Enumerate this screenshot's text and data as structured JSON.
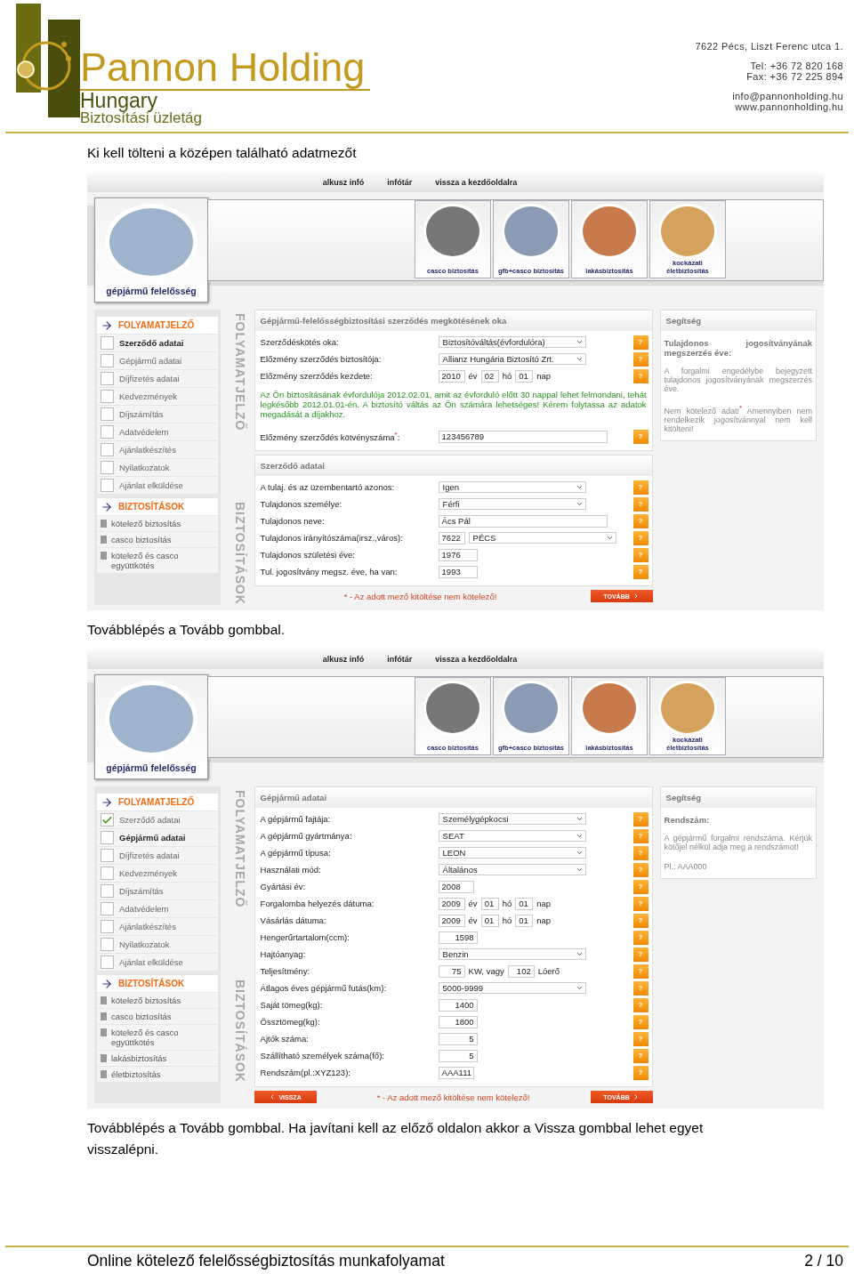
{
  "header": {
    "brand": "Pannon Holding",
    "country": "Hungary",
    "division": "Biztosítási üzletág",
    "contact": [
      "7622 Pécs, Liszt Ferenc utca 1.",
      "Tel: +36 72 820 168",
      "Fax: +36 72 225 894",
      "info@pannonholding.hu",
      "www.pannonholding.hu"
    ]
  },
  "sections": [
    {
      "caption": "Ki kell tölteni a középen található adatmezőt",
      "screenshot": {
        "nav_links": [
          "alkusz infó",
          "infótár",
          "vissza a kezdőoldalra"
        ],
        "main_card": {
          "label": "gépjármű felelősség"
        },
        "product_cards": [
          {
            "label": "casco biztosítás"
          },
          {
            "label": "gfb+casco biztosítás"
          },
          {
            "label": "lakásbiztosítás"
          },
          {
            "label": "kockázati életbiztosítás"
          }
        ],
        "progress": {
          "title": "FOLYAMATJELZŐ",
          "side_label": "FOLYAMATJELZŐ",
          "steps": [
            {
              "label": "Szerződő adatai",
              "checked": false,
              "selected": true
            },
            {
              "label": "Gépjármű adatai",
              "checked": false,
              "selected": false
            },
            {
              "label": "Díjfizetés adatai",
              "checked": false,
              "selected": false
            },
            {
              "label": "Kedvezmények",
              "checked": false,
              "selected": false
            },
            {
              "label": "Díjszámítás",
              "checked": false,
              "selected": false
            },
            {
              "label": "Adatvédelem",
              "checked": false,
              "selected": false
            },
            {
              "label": "Ajánlatkészítés",
              "checked": false,
              "selected": false
            },
            {
              "label": "Nyilatkozatok",
              "checked": false,
              "selected": false
            },
            {
              "label": "Ajánlat elküldése",
              "checked": false,
              "selected": false
            }
          ]
        },
        "insurances": {
          "title": "BIZTOSÍTÁSOK",
          "side_label": "BIZTOSÍTÁSOK",
          "items": [
            "kötelező biztosítás",
            "casco biztosítás",
            "kötelező és casco együttkötés"
          ]
        },
        "panels": [
          {
            "title": "Gépjármű-felelősségbiztosítási szerződés megkötésének oka",
            "rows": [
              {
                "kind": "select",
                "label": "Szerződéskötés oka:",
                "values": [
                  "Biztosítóváltás(évfordulóra)"
                ],
                "help": "?"
              },
              {
                "kind": "select",
                "label": "Előzmény szerződés biztosítója:",
                "values": [
                  "Allianz Hungária Biztosító Zrt."
                ],
                "help": "?"
              },
              {
                "kind": "date",
                "label": "Előzmény szerződés kezdete:",
                "values": [
                  "2010",
                  "02",
                  "01"
                ],
                "units": [
                  "év",
                  "hó",
                  "nap"
                ],
                "help": "?"
              },
              {
                "kind": "notice",
                "text": "Az Ön biztosításának évfordulója 2012.02.01, amit az évforduló előtt 30 nappal lehet felmondani, tehát legkésőbb 2012.01.01-én. A biztosító váltás az Ön számára lehetséges! Kérem folytassa az adatok megadását a díjakhoz."
              },
              {
                "kind": "text",
                "label": "Előzmény szerződés kötvényszáma$^{*}$:",
                "values": [
                  "123456789"
                ],
                "help": "?"
              }
            ]
          },
          {
            "title": "Szerződő adatai",
            "rows": [
              {
                "kind": "select",
                "label": "A tulaj. és az üzembentartó azonos:",
                "values": [
                  "Igen"
                ],
                "help": "?"
              },
              {
                "kind": "select",
                "label": "Tulajdonos személye:",
                "values": [
                  "Férfi"
                ],
                "help": "?"
              },
              {
                "kind": "text",
                "label": "Tulajdonos neve:",
                "values": [
                  "Ács Pál"
                ],
                "help": "?"
              },
              {
                "kind": "city",
                "label": "Tulajdonos irányítószáma(irsz.,város):",
                "values": [
                  "7622",
                  "PÉCS"
                ],
                "help": "?"
              },
              {
                "kind": "short",
                "label": "Tulajdonos születési éve:",
                "values": [
                  "1976"
                ],
                "help": "?"
              },
              {
                "kind": "short",
                "label": "Tul. jogosítvány megsz. éve, ha van:",
                "values": [
                  "1993"
                ],
                "help": "?"
              }
            ]
          }
        ],
        "note": "* - Az adott mező kitöltése nem kötelező!",
        "buttons": [
          {
            "kind": "next",
            "label": "TOVÁBB"
          }
        ],
        "help_panel": {
          "title": "Segítség",
          "heading": "Tulajdonos jogosítványának megszerzés éve:",
          "paragraphs": [
            "A forgalmi engedélybe bejegyzett tulajdonos jogosítványának megszerzés éve.",
            "Nem kötelező adat!$^{*}$ Amennyiben nem rendelkezik jogosítvánnyal nem kell kitölteni!"
          ]
        }
      }
    },
    {
      "caption": "Továbblépés a Tovább gombbal.",
      "screenshot": {
        "nav_links": [
          "alkusz infó",
          "infótár",
          "vissza a kezdőoldalra"
        ],
        "main_card": {
          "label": "gépjármű felelősség"
        },
        "product_cards": [
          {
            "label": "casco biztosítás"
          },
          {
            "label": "gfb+casco biztosítás"
          },
          {
            "label": "lakásbiztosítás"
          },
          {
            "label": "kockázati életbiztosítás"
          }
        ],
        "progress": {
          "title": "FOLYAMATJELZŐ",
          "side_label": "FOLYAMATJELZŐ",
          "steps": [
            {
              "label": "Szerződő adatai",
              "checked": true,
              "selected": false
            },
            {
              "label": "Gépjármű adatai",
              "checked": false,
              "selected": true
            },
            {
              "label": "Díjfizetés adatai",
              "checked": false,
              "selected": false
            },
            {
              "label": "Kedvezmények",
              "checked": false,
              "selected": false
            },
            {
              "label": "Díjszámítás",
              "checked": false,
              "selected": false
            },
            {
              "label": "Adatvédelem",
              "checked": false,
              "selected": false
            },
            {
              "label": "Ajánlatkészítés",
              "checked": false,
              "selected": false
            },
            {
              "label": "Nyilatkozatok",
              "checked": false,
              "selected": false
            },
            {
              "label": "Ajánlat elküldése",
              "checked": false,
              "selected": false
            }
          ]
        },
        "insurances": {
          "title": "BIZTOSÍTÁSOK",
          "side_label": "BIZTOSÍTÁSOK",
          "items": [
            "kötelező biztosítás",
            "casco biztosítás",
            "kötelező és casco együttkötés",
            "lakásbiztosítás",
            "életbiztosítás"
          ]
        },
        "panels": [
          {
            "title": "Gépjármű adatai",
            "rows": [
              {
                "kind": "select",
                "label": "A gépjármű fajtája:",
                "values": [
                  "Személygépkocsi"
                ],
                "help": "?"
              },
              {
                "kind": "select",
                "label": "A gépjármű gyártmánya:",
                "values": [
                  "SEAT"
                ],
                "help": "?"
              },
              {
                "kind": "select",
                "label": "A gépjármű típusa:",
                "values": [
                  "LEON"
                ],
                "help": "?"
              },
              {
                "kind": "select",
                "label": "Használati mód:",
                "values": [
                  "Általános"
                ],
                "help": "?"
              },
              {
                "kind": "short",
                "label": "Gyártási év:",
                "values": [
                  "2008"
                ],
                "help": "?"
              },
              {
                "kind": "date",
                "label": "Forgalomba helyezés dátuma:",
                "values": [
                  "2009",
                  "01",
                  "01"
                ],
                "units": [
                  "év",
                  "hó",
                  "nap"
                ],
                "help": "?"
              },
              {
                "kind": "date",
                "label": "Vásárlás dátuma:",
                "values": [
                  "2009",
                  "01",
                  "01"
                ],
                "units": [
                  "év",
                  "hó",
                  "nap"
                ],
                "help": "?"
              },
              {
                "kind": "number",
                "label": "Hengerűrtartalom(ccm):",
                "values": [
                  "1598"
                ],
                "help": "?"
              },
              {
                "kind": "select",
                "label": "Hajtóanyag:",
                "values": [
                  "Benzin"
                ],
                "help": "?"
              },
              {
                "kind": "power",
                "label": "Teljesítmény:",
                "values": [
                  "75",
                  "102"
                ],
                "units": [
                  "KW, vagy",
                  "Lóerő"
                ],
                "help": "?"
              },
              {
                "kind": "select",
                "label": "Átlagos éves gépjármű futás(km):",
                "values": [
                  "5000-9999"
                ],
                "help": "?"
              },
              {
                "kind": "number",
                "label": "Saját tömeg(kg):",
                "values": [
                  "1400"
                ],
                "help": "?"
              },
              {
                "kind": "number",
                "label": "Össztömeg(kg):",
                "values": [
                  "1800"
                ],
                "help": "?"
              },
              {
                "kind": "number",
                "label": "Ajtók száma:",
                "values": [
                  "5"
                ],
                "help": "?"
              },
              {
                "kind": "number",
                "label": "Szállítható személyek száma(fő):",
                "values": [
                  "5"
                ],
                "help": "?"
              },
              {
                "kind": "short",
                "label": "Rendszám(pl.:XYZ123):",
                "values": [
                  "AAA111"
                ],
                "help": "?"
              }
            ]
          }
        ],
        "note": "* - Az adott mező kitöltése nem kötelező!",
        "buttons": [
          {
            "kind": "back",
            "label": "VISSZA"
          },
          {
            "kind": "next",
            "label": "TOVÁBB"
          }
        ],
        "help_panel": {
          "title": "Segítség",
          "heading": "Rendszám:",
          "paragraphs": [
            "A gépjármű forgalmi rendszáma. Kérjük kötőjel nélkül adja meg a rendszámot!",
            "Pl.: AAA000"
          ]
        }
      }
    },
    {
      "caption": "Továbblépés a Tovább gombbal. Ha javítani kell az előző oldalon akkor a Vissza gombbal lehet egyet visszalépni."
    }
  ],
  "footer": {
    "title": "Online kötelező felelősségbiztosítás munkafolyamat",
    "page": "2 / 10"
  }
}
